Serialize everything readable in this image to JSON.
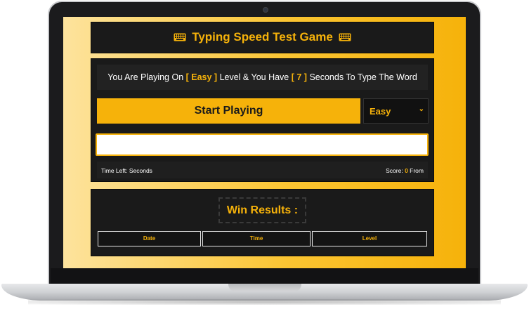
{
  "game": {
    "title": "Typing Speed Test Game",
    "message": {
      "prefix": "You Are Playing On ",
      "level": "[ Easy ]",
      "middle": " Level & You Have ",
      "seconds": "[ 7 ]",
      "suffix": " Seconds To Type The Word"
    },
    "start_button": "Start Playing",
    "level_select": {
      "selected": "Easy"
    },
    "input": {
      "value": "",
      "placeholder": ""
    },
    "stats": {
      "time_left_label": "Time Left: ",
      "time_left_unit": "Seconds",
      "score_label": "Score: ",
      "score_value": "0",
      "score_from": " From"
    }
  },
  "results": {
    "title": "Win Results :",
    "columns": [
      "Date",
      "Time",
      "Level"
    ]
  },
  "colors": {
    "accent": "#f6b20a",
    "panel": "#1a1a1a",
    "text": "#ffffff"
  },
  "icons": {
    "title_left": "keyboard-icon",
    "title_right": "keyboard-icon",
    "select_arrow": "chevron-down-icon"
  }
}
